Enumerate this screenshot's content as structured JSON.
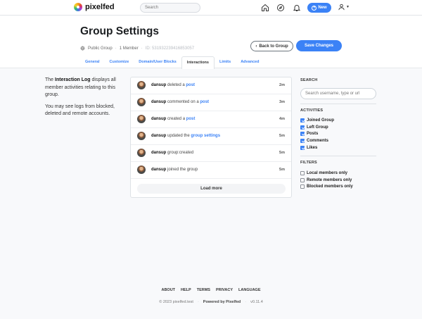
{
  "nav": {
    "brand": "pixelfed",
    "search_placeholder": "Search",
    "new_label": "New"
  },
  "header": {
    "title": "Group Settings",
    "visibility": "Public Group",
    "members": "1 Member",
    "group_id": "ID: 531932239416853057",
    "back_label": "Back to Group",
    "save_label": "Save Changes"
  },
  "tabs": [
    "General",
    "Customize",
    "Domain/User Blocks",
    "Interactions",
    "Limits",
    "Advanced"
  ],
  "active_tab": "Interactions",
  "info": {
    "p1_bold": "Interaction Log",
    "p1_pre": "The ",
    "p1_post": " displays all member activities relating to this group.",
    "p2": "You may see logs from blocked, deleted and remote accounts."
  },
  "log": [
    {
      "user": "dansup",
      "action": " deleted a ",
      "link": "post",
      "time": "2m"
    },
    {
      "user": "dansup",
      "action": " commented on a ",
      "link": "post",
      "time": "3m"
    },
    {
      "user": "dansup",
      "action": " created a ",
      "link": "post",
      "time": "4m"
    },
    {
      "user": "dansup",
      "action": " updated the ",
      "link": "group settings",
      "time": "5m"
    },
    {
      "user": "dansup",
      "action": " group:created",
      "link": "",
      "time": "5m"
    },
    {
      "user": "dansup",
      "action": " joined the group",
      "link": "",
      "time": "5m"
    }
  ],
  "load_more": "Load more",
  "sidebar": {
    "search_heading": "SEARCH",
    "search_placeholder": "Search username, type or url",
    "activities_heading": "ACTIVITIES",
    "activities": [
      {
        "label": "Joined Group",
        "checked": true
      },
      {
        "label": "Left Group",
        "checked": true
      },
      {
        "label": "Posts",
        "checked": true
      },
      {
        "label": "Comments",
        "checked": true
      },
      {
        "label": "Likes",
        "checked": true
      }
    ],
    "filters_heading": "FILTERS",
    "filters": [
      {
        "label": "Local members only",
        "checked": false
      },
      {
        "label": "Remote members only",
        "checked": false
      },
      {
        "label": "Blocked members only",
        "checked": false
      }
    ]
  },
  "footer": {
    "links": [
      "ABOUT",
      "HELP",
      "TERMS",
      "PRIVACY",
      "LANGUAGE"
    ],
    "copyright": "© 2023 pixelfed.test",
    "powered": "Powered by Pixelfed",
    "version": "v0.11.4"
  },
  "colors": {
    "accent": "#3b82f6"
  }
}
